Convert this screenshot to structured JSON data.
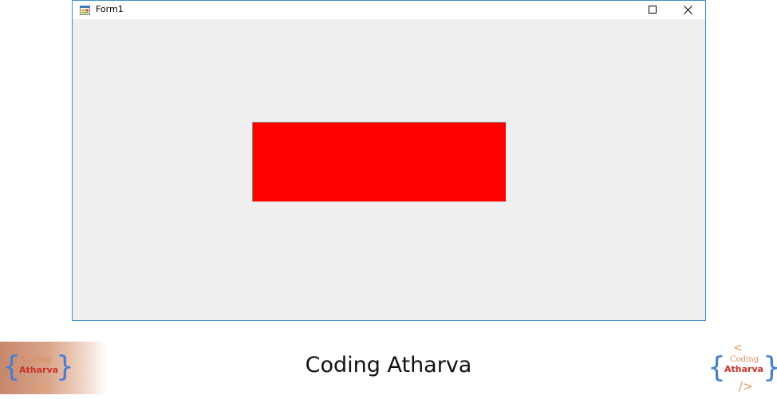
{
  "window": {
    "title": "Form1",
    "icon": "winforms-app-icon",
    "controls": [
      "maximize-icon",
      "close-icon"
    ]
  },
  "panel": {
    "color": "#ff0000"
  },
  "footer": {
    "caption": "Coding Atharva",
    "logo": {
      "line1": "Coding",
      "line2": "Atharva",
      "brace_open": "{",
      "brace_close": "}",
      "tag_open": "<",
      "tag_close": "/>"
    }
  },
  "colors": {
    "window_border": "#3c8ed8",
    "client_bg": "#efefef",
    "brace_blue": "#4a7fd0",
    "tag_orange": "#e39a5c",
    "atharva_red": "#c9332b"
  }
}
